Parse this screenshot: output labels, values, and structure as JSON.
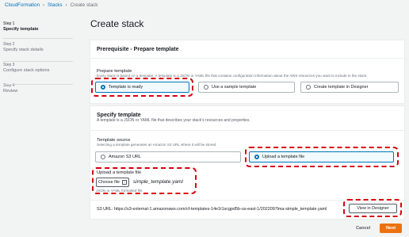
{
  "breadcrumb": {
    "root": "CloudFormation",
    "stacks": "Stacks",
    "current": "Create stack"
  },
  "sidebar": {
    "steps": [
      {
        "num": "Step 1",
        "label": "Specify template"
      },
      {
        "num": "Step 2",
        "label": "Specify stack details"
      },
      {
        "num": "Step 3",
        "label": "Configure stack options"
      },
      {
        "num": "Step 4",
        "label": "Review"
      }
    ]
  },
  "page_title": "Create stack",
  "prereq": {
    "title": "Prerequisite - Prepare template",
    "label": "Prepare template",
    "desc": "Every stack is based on a template. A template is a JSON or YAML file that contains configuration information about the AWS resources you want to include in the stack.",
    "options": [
      "Template is ready",
      "Use a sample template",
      "Create template in Designer"
    ]
  },
  "specify": {
    "title": "Specify template",
    "subtitle": "A template is a JSON or YAML file that describes your stack's resources and properties.",
    "source_label": "Template source",
    "source_desc": "Selecting a template generates an Amazon S3 URL where it will be stored.",
    "options": [
      "Amazon S3 URL",
      "Upload a template file"
    ],
    "upload_label": "Upload a template file",
    "choose_file": "Choose file",
    "file_name": "simple_template.yaml",
    "file_hint": "JSON or YAML formatted file",
    "s3_label": "S3 URL:",
    "s3_url": "https://s3-external-1.amazonaws.com/cf-templates-14e1t1scgpd5b-us-east-1/2022097lma-simple_template.yaml",
    "designer_button": "View in Designer"
  },
  "footer": {
    "cancel": "Cancel",
    "next": "Next"
  },
  "colors": {
    "accent": "#0073bb",
    "primary": "#ec7211",
    "highlight": "#d4000f"
  }
}
